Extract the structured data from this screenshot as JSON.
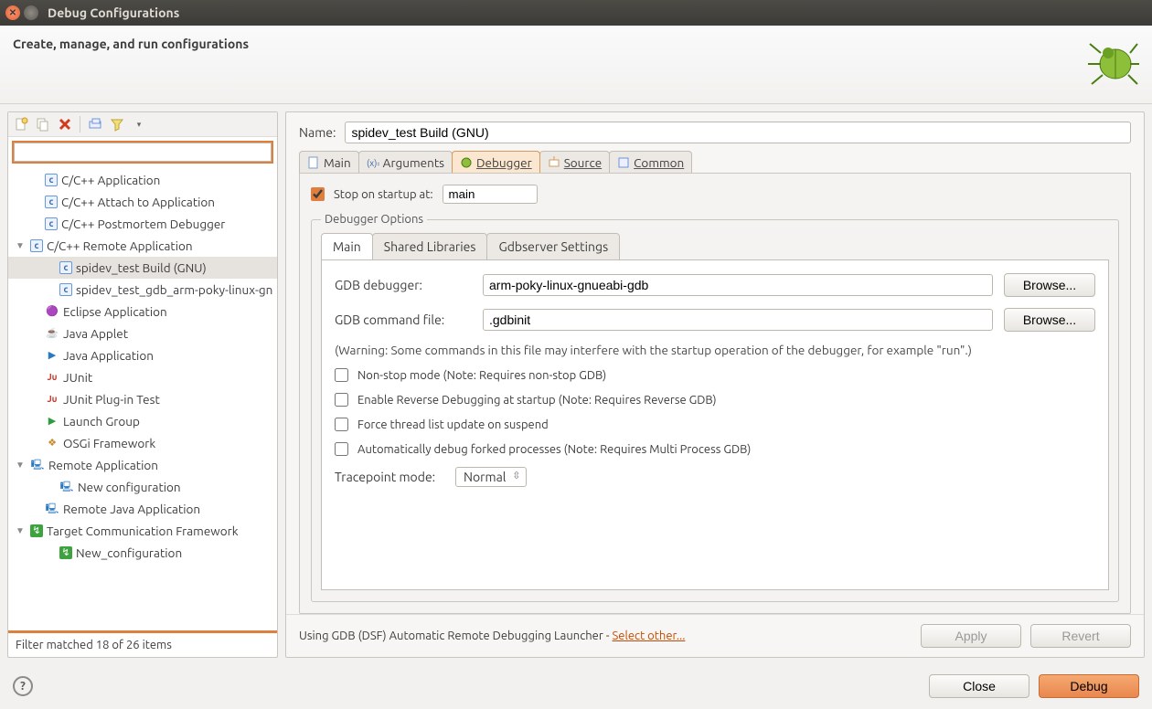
{
  "window": {
    "title": "Debug Configurations"
  },
  "header": {
    "title": "Create, manage, and run configurations"
  },
  "tree": {
    "filter": "",
    "items": [
      {
        "label": "C/C++ Application",
        "arrow": "",
        "indent": 1,
        "icon": "c"
      },
      {
        "label": "C/C++ Attach to Application",
        "arrow": "",
        "indent": 1,
        "icon": "c"
      },
      {
        "label": "C/C++ Postmortem Debugger",
        "arrow": "",
        "indent": 1,
        "icon": "c"
      },
      {
        "label": "C/C++ Remote Application",
        "arrow": "▼",
        "indent": 0,
        "icon": "c"
      },
      {
        "label": "spidev_test Build (GNU)",
        "arrow": "",
        "indent": 2,
        "icon": "c",
        "sel": true
      },
      {
        "label": "spidev_test_gdb_arm-poky-linux-gn",
        "arrow": "",
        "indent": 2,
        "icon": "c"
      },
      {
        "label": "Eclipse Application",
        "arrow": "",
        "indent": 1,
        "icon": "ecl"
      },
      {
        "label": "Java Applet",
        "arrow": "",
        "indent": 1,
        "icon": "applet"
      },
      {
        "label": "Java Application",
        "arrow": "",
        "indent": 1,
        "icon": "japp"
      },
      {
        "label": "JUnit",
        "arrow": "",
        "indent": 1,
        "icon": "ju"
      },
      {
        "label": "JUnit Plug-in Test",
        "arrow": "",
        "indent": 1,
        "icon": "ju"
      },
      {
        "label": "Launch Group",
        "arrow": "",
        "indent": 1,
        "icon": "play"
      },
      {
        "label": "OSGi Framework",
        "arrow": "",
        "indent": 1,
        "icon": "osgi"
      },
      {
        "label": "Remote Application",
        "arrow": "▼",
        "indent": 0,
        "icon": "remote"
      },
      {
        "label": "New configuration",
        "arrow": "",
        "indent": 2,
        "icon": "remote"
      },
      {
        "label": "Remote Java Application",
        "arrow": "",
        "indent": 1,
        "icon": "rjava"
      },
      {
        "label": "Target Communication Framework",
        "arrow": "▼",
        "indent": 0,
        "icon": "tcf"
      },
      {
        "label": "New_configuration",
        "arrow": "",
        "indent": 2,
        "icon": "tcfnew"
      }
    ],
    "footer": "Filter matched 18 of 26 items"
  },
  "form": {
    "name_label": "Name:",
    "name_value": "spidev_test Build (GNU)",
    "tabs": [
      "Main",
      "Arguments",
      "Debugger",
      "Source",
      "Common"
    ],
    "stop_label": "Stop on startup at:",
    "stop_value": "main",
    "debugger_options_legend": "Debugger Options",
    "subtabs": [
      "Main",
      "Shared Libraries",
      "Gdbserver Settings"
    ],
    "gdb_label": "GDB debugger:",
    "gdb_value": "arm-poky-linux-gnueabi-gdb",
    "cmdfile_label": "GDB command file:",
    "cmdfile_value": ".gdbinit",
    "browse": "Browse...",
    "warning_text": "(Warning: Some commands in this file may interfere with the startup operation of the debugger, for example \"run\".)",
    "cb1": "Non-stop mode (Note: Requires non-stop GDB)",
    "cb2": "Enable Reverse Debugging at startup (Note: Requires Reverse GDB)",
    "cb3": "Force thread list update on suspend",
    "cb4": "Automatically debug forked processes (Note: Requires Multi Process GDB)",
    "tracepoint_label": "Tracepoint mode:",
    "tracepoint_value": "Normal",
    "launcher_prefix": "Using GDB (DSF) Automatic Remote Debugging Launcher - ",
    "launcher_link": "Select other...",
    "apply": "Apply",
    "revert": "Revert"
  },
  "buttons": {
    "close": "Close",
    "debug": "Debug"
  }
}
